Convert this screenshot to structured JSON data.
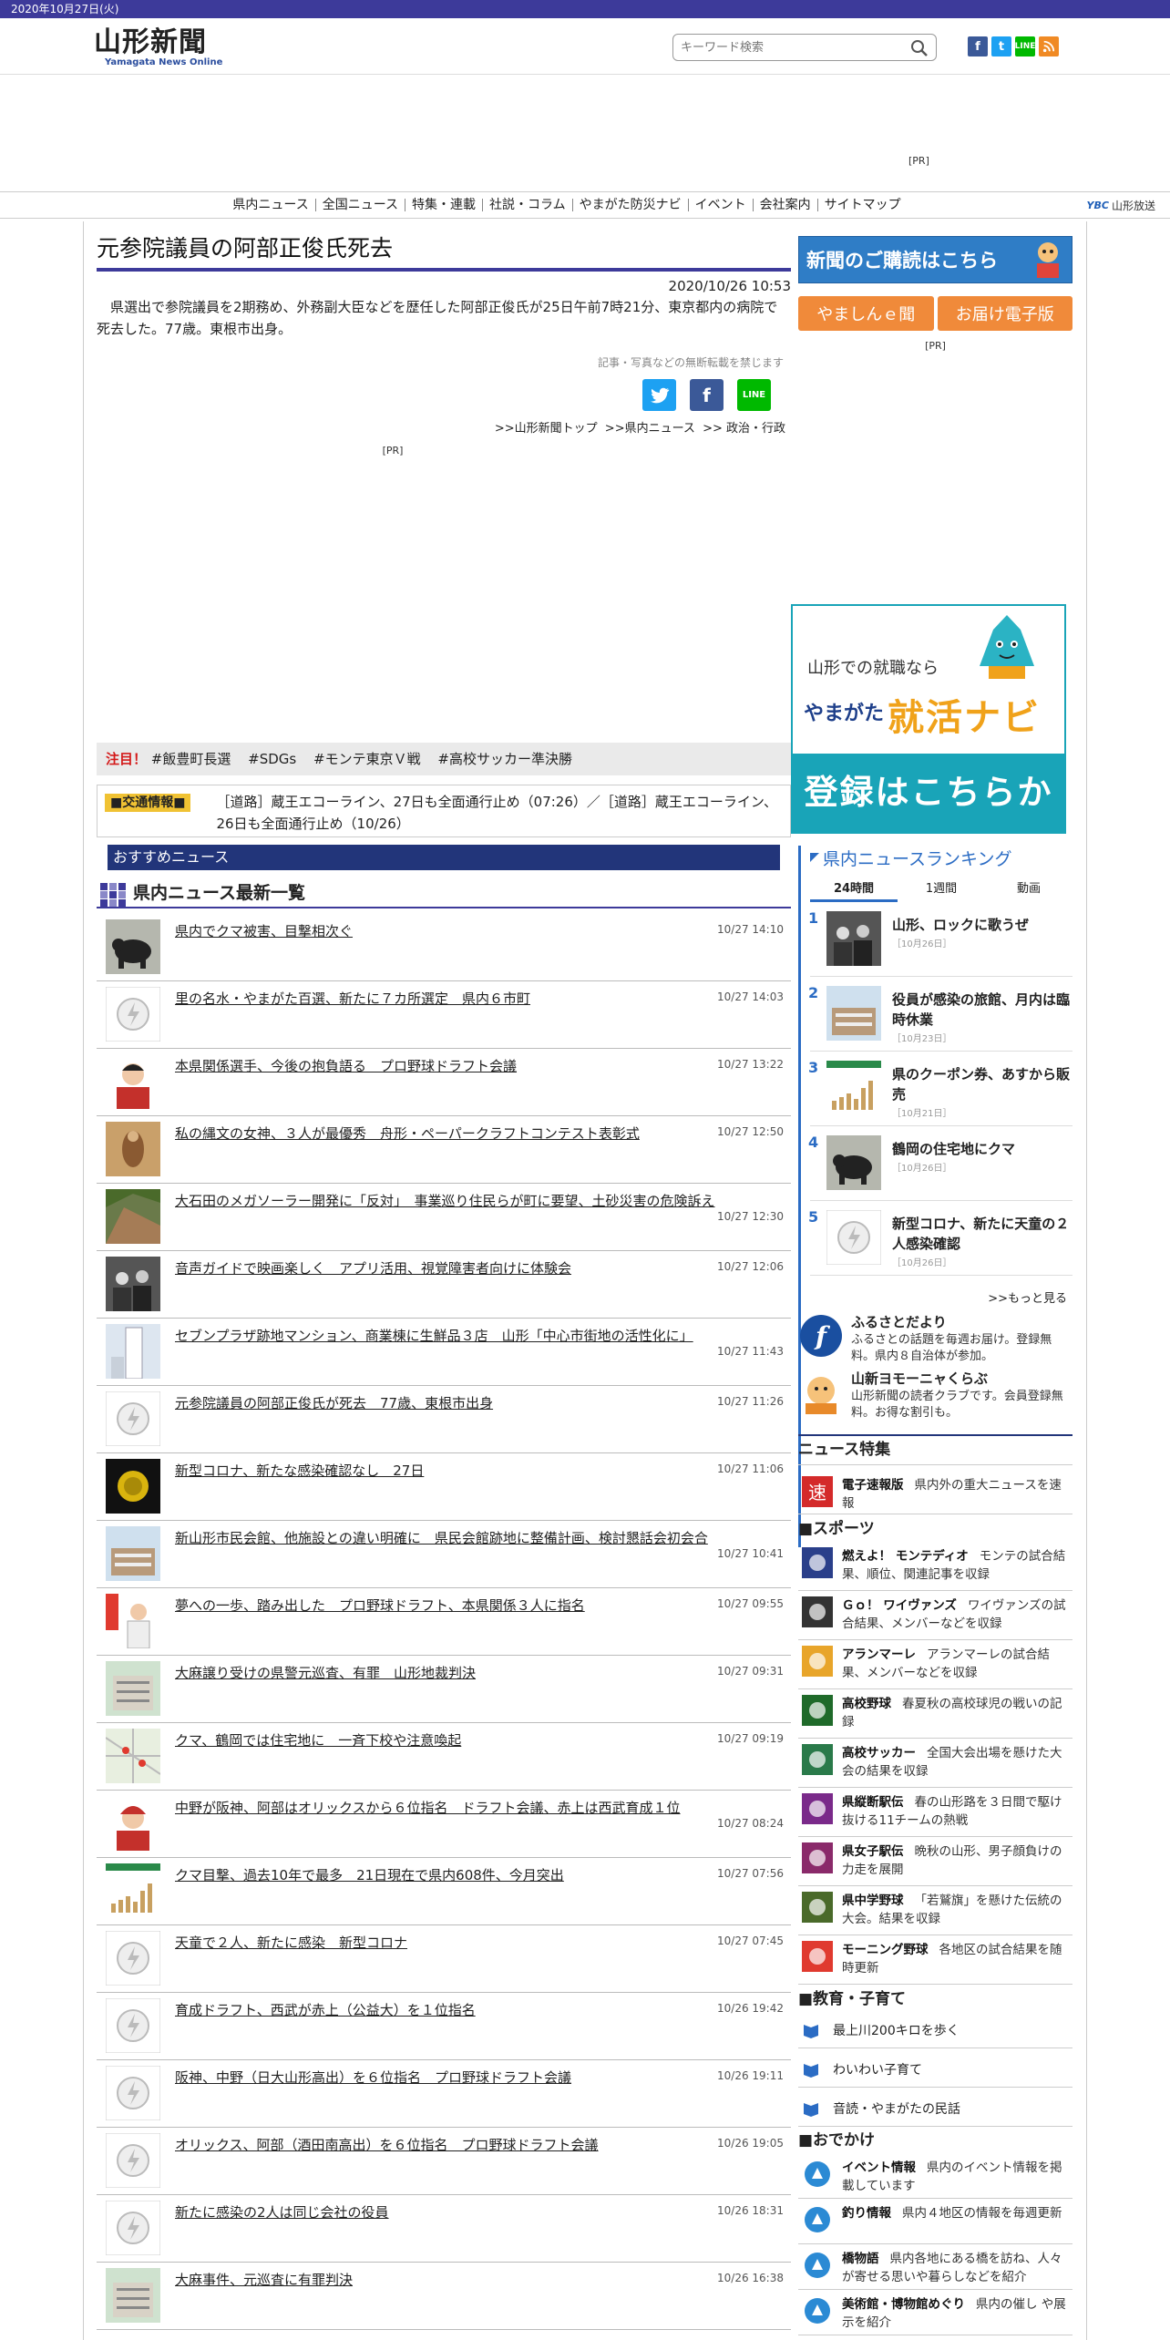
{
  "topbar": {
    "date": "2020年10月27日(火)"
  },
  "header": {
    "logo_text": "山形新聞",
    "logo_sub": "Yamagata News Online",
    "search_placeholder": "キーワード検索",
    "social": [
      "facebook-icon",
      "twitter-icon",
      "line-icon",
      "rss-icon"
    ],
    "ad_pr": "[PR]"
  },
  "nav": {
    "items": [
      "県内ニュース",
      "全国ニュース",
      "特集・連載",
      "社説・コラム",
      "やまがた防災ナビ",
      "イベント",
      "会社案内",
      "サイトマップ"
    ],
    "ybc": "山形放送",
    "ybc_logo": "YBC"
  },
  "article": {
    "title": "元参院議員の阿部正俊氏死去",
    "date": "2020/10/26 10:53",
    "body": "県選出で参院議員を2期務め、外務副大臣などを歴任した阿部正俊氏が25日午前7時21分、東京都内の病院で死去した。77歳。東根市出身。",
    "copyright": "記事・写真などの無断転載を禁じます",
    "breadcrumb": [
      ">>山形新聞トップ",
      ">>県内ニュース",
      ">> 政治・行政"
    ],
    "pr": "[PR]"
  },
  "hot": {
    "label": "注目！",
    "tags": [
      "#飯豊町長選",
      "#SDGs",
      "#モンテ東京Ｖ戦",
      "#高校サッカー準決勝"
    ]
  },
  "traffic": {
    "label": "■交通情報■",
    "text": "［道路］蔵王エコーライン、27日も全面通行止め（07:26）／［道路］蔵王エコーライン、26日も全面通行止め（10/26）"
  },
  "recommend_bar": "おすすめニュース",
  "latest": {
    "heading": "県内ニュース最新一覧",
    "items": [
      {
        "title": "県内でクマ被害、目撃相次ぐ",
        "time": "10/27 14:10",
        "thumb": "bear"
      },
      {
        "title": "里の名水・やまがた百選、新たに７カ所選定　県内６市町",
        "time": "10/27 14:03",
        "thumb": "none"
      },
      {
        "title": "本県関係選手、今後の抱負語る　プロ野球ドラフト会議",
        "time": "10/27 13:22",
        "thumb": "person"
      },
      {
        "title": "私の縄文の女神、３人が最優秀　舟形・ペーパークラフトコンテスト表彰式",
        "time": "10/27 12:50",
        "thumb": "craft"
      },
      {
        "title": "大石田のメガソーラー開発に「反対」　事業巡り住民らが町に要望、土砂災害の危険訴え",
        "time": "10/27 12:30",
        "thumb": "slope"
      },
      {
        "title": "音声ガイドで映画楽しく　アプリ活用、視覚障害者向けに体験会",
        "time": "10/27 12:06",
        "thumb": "group"
      },
      {
        "title": "セブンプラザ跡地マンション、商業棟に生鮮品３店　山形「中心市街地の活性化に」",
        "time": "10/27 11:43",
        "thumb": "building"
      },
      {
        "title": "元参院議員の阿部正俊氏が死去　77歳、東根市出身",
        "time": "10/27 11:26",
        "thumb": "none"
      },
      {
        "title": "新型コロナ、新たな感染確認なし　27日",
        "time": "10/27 11:06",
        "thumb": "virus"
      },
      {
        "title": "新山形市民会館、他施設との違い明確に　県民会館跡地に整備計画、検討懇話会初会合",
        "time": "10/27 10:41",
        "thumb": "hall"
      },
      {
        "title": "夢への一歩、踏み出した　プロ野球ドラフト、本県関係３人に指名",
        "time": "10/27 09:55",
        "thumb": "draft"
      },
      {
        "title": "大麻譲り受けの県警元巡査、有罪　山形地裁判決",
        "time": "10/27 09:31",
        "thumb": "court"
      },
      {
        "title": "クマ、鶴岡では住宅地に　一斉下校や注意喚起",
        "time": "10/27 09:19",
        "thumb": "map"
      },
      {
        "title": "中野が阪神、阿部はオリックスから６位指名　ドラフト会議、赤上は西武育成１位",
        "time": "10/27 08:24",
        "thumb": "player"
      },
      {
        "title": "クマ目撃、過去10年で最多　21日現在で県内608件、今月突出",
        "time": "10/27 07:56",
        "thumb": "chart"
      },
      {
        "title": "天童で２人、新たに感染　新型コロナ",
        "time": "10/27 07:45",
        "thumb": "none"
      },
      {
        "title": "育成ドラフト、西武が赤上（公益大）を１位指名",
        "time": "10/26 19:42",
        "thumb": "none"
      },
      {
        "title": "阪神、中野（日大山形高出）を６位指名　プロ野球ドラフト会議",
        "time": "10/26 19:11",
        "thumb": "none"
      },
      {
        "title": "オリックス、阿部（酒田南高出）を６位指名　プロ野球ドラフト会議",
        "time": "10/26 19:05",
        "thumb": "none"
      },
      {
        "title": "新たに感染の2人は同じ会社の役員",
        "time": "10/26 18:31",
        "thumb": "none"
      },
      {
        "title": "大麻事件、元巡査に有罪判決",
        "time": "10/26 16:38",
        "thumb": "court"
      }
    ]
  },
  "sidebar": {
    "subscribe": "新聞のご購読はこちら",
    "buttons": [
      "やましんｅ聞",
      "お届け電子版"
    ],
    "pr": "[PR]",
    "job_ad": {
      "line1": "山形での就職なら",
      "line2": "やまがた",
      "line3": "就活ナビ",
      "cta": "登録はこちらから"
    },
    "ranking": {
      "title": "県内ニュースランキング",
      "tabs": [
        "24時間",
        "1週間",
        "動画"
      ],
      "items": [
        {
          "rank": "1",
          "title": "山形、ロックに歌うぜ",
          "date": "［10月26日］"
        },
        {
          "rank": "2",
          "title": "役員が感染の旅館、月内は臨時休業",
          "date": "［10月23日］"
        },
        {
          "rank": "3",
          "title": "県のクーポン券、あすから販売",
          "date": "［10月21日］"
        },
        {
          "rank": "4",
          "title": "鶴岡の住宅地にクマ",
          "date": "［10月26日］"
        },
        {
          "rank": "5",
          "title": "新型コロナ、新たに天童の２人感染確認",
          "date": "［10月26日］"
        }
      ],
      "more": ">>もっと見る"
    },
    "promos": [
      {
        "title": "ふるさとだより",
        "desc": "ふるさとの話題を毎週お届け。登録無料。県内８自治体が参加。"
      },
      {
        "title": "山新ヨモーニャくらぶ",
        "desc": "山形新聞の読者クラブです。会員登録無料。お得な割引も。"
      }
    ],
    "special": {
      "heading": "ニュース特集",
      "breaking": {
        "name": "電子速報版",
        "desc": "県内外の重大ニュースを速報"
      },
      "sports_heading": "■スポーツ",
      "sports": [
        {
          "name": "燃えよ！ モンテディオ",
          "desc": "モンテの試合結果、順位、関連記事を収録"
        },
        {
          "name": "Ｇｏ！ ワイヴァンズ",
          "desc": "ワイヴァンズの試合結果、メンバーなどを収録"
        },
        {
          "name": "アランマーレ",
          "desc": "アランマーレの試合結果、メンバーなどを収録"
        },
        {
          "name": "高校野球",
          "desc": "春夏秋の高校球児の戦いの記録"
        },
        {
          "name": "高校サッカー",
          "desc": "全国大会出場を懸けた大会の結果を収録"
        },
        {
          "name": "県縦断駅伝",
          "desc": "春の山形路を３日間で駆け抜ける11チームの熱戦"
        },
        {
          "name": "県女子駅伝",
          "desc": "晩秋の山形、男子顔負けの力走を展開"
        },
        {
          "name": "県中学野球",
          "desc": "「若鷲旗」を懸けた伝統の大会。結果を収録"
        },
        {
          "name": "モーニング野球",
          "desc": "各地区の試合結果を随時更新"
        }
      ],
      "edu_heading": "■教育・子育て",
      "edu": [
        "最上川200キロを歩く",
        "わいわい子育て",
        "音読・やまがたの民話"
      ],
      "out_heading": "■おでかけ",
      "outing": [
        {
          "name": "イベント情報",
          "desc": "県内のイベント情報を掲載しています"
        },
        {
          "name": "釣り情報",
          "desc": "県内４地区の情報を毎週更新"
        },
        {
          "name": "橋物語",
          "desc": "県内各地にある橋を訪ね、人々が寄せる思いや暮らしなどを紹介"
        },
        {
          "name": "美術館・博物館めぐり",
          "desc": "県内の催し や展示を紹介"
        }
      ]
    }
  },
  "colors": {
    "brand": "#3d3a9a",
    "nav_blue": "#22357a",
    "accent_blue": "#2b6cc4",
    "orange": "#f08a3a",
    "teal": "#19a4b8"
  }
}
